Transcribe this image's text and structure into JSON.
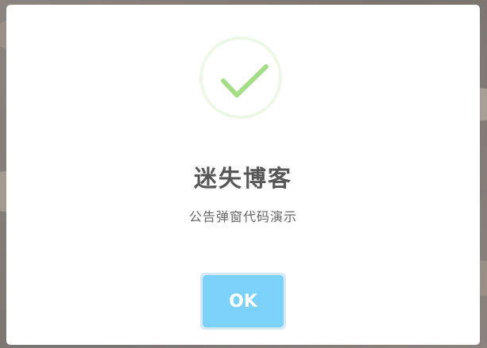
{
  "dialog": {
    "icon": "success-check-icon",
    "title": "迷失博客",
    "message": "公告弹窗代码演示",
    "confirm_label": "OK"
  },
  "colors": {
    "check": "#a5dc86",
    "ring": "#eef8e6",
    "title": "#575757",
    "message": "#666666",
    "button": "#7cd1f9",
    "button_focus_ring": "#d6e9f5",
    "overlay": "#7f7a78"
  }
}
